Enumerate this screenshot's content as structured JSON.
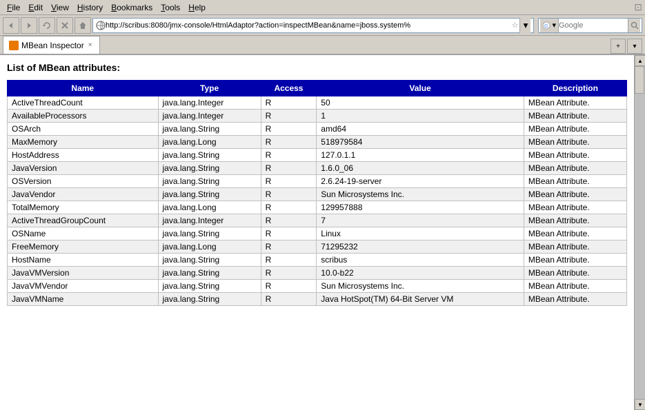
{
  "menubar": {
    "items": [
      {
        "label": "File",
        "underline": "F"
      },
      {
        "label": "Edit",
        "underline": "E"
      },
      {
        "label": "View",
        "underline": "V"
      },
      {
        "label": "History",
        "underline": "H"
      },
      {
        "label": "Bookmarks",
        "underline": "B"
      },
      {
        "label": "Tools",
        "underline": "T"
      },
      {
        "label": "Help",
        "underline": "H"
      }
    ]
  },
  "toolbar": {
    "url": "http://scribus:8080/jmx-console/HtmlAdaptor?action=inspectMBean&name=jboss.system%",
    "search_placeholder": "Google"
  },
  "tab": {
    "label": "MBean Inspector",
    "close": "×"
  },
  "page": {
    "title": "List of MBean attributes:",
    "table": {
      "headers": [
        "Name",
        "Type",
        "Access",
        "Value",
        "Description"
      ],
      "rows": [
        {
          "name": "ActiveThreadCount",
          "type": "java.lang.Integer",
          "access": "R",
          "value": "50",
          "description": "MBean Attribute."
        },
        {
          "name": "AvailableProcessors",
          "type": "java.lang.Integer",
          "access": "R",
          "value": "1",
          "description": "MBean Attribute."
        },
        {
          "name": "OSArch",
          "type": "java.lang.String",
          "access": "R",
          "value": "amd64",
          "description": "MBean Attribute."
        },
        {
          "name": "MaxMemory",
          "type": "java.lang.Long",
          "access": "R",
          "value": "518979584",
          "description": "MBean Attribute."
        },
        {
          "name": "HostAddress",
          "type": "java.lang.String",
          "access": "R",
          "value": "127.0.1.1",
          "description": "MBean Attribute."
        },
        {
          "name": "JavaVersion",
          "type": "java.lang.String",
          "access": "R",
          "value": "1.6.0_06",
          "description": "MBean Attribute."
        },
        {
          "name": "OSVersion",
          "type": "java.lang.String",
          "access": "R",
          "value": "2.6.24-19-server",
          "description": "MBean Attribute."
        },
        {
          "name": "JavaVendor",
          "type": "java.lang.String",
          "access": "R",
          "value": "Sun Microsystems Inc.",
          "description": "MBean Attribute."
        },
        {
          "name": "TotalMemory",
          "type": "java.lang.Long",
          "access": "R",
          "value": "129957888",
          "description": "MBean Attribute."
        },
        {
          "name": "ActiveThreadGroupCount",
          "type": "java.lang.Integer",
          "access": "R",
          "value": "7",
          "description": "MBean Attribute."
        },
        {
          "name": "OSName",
          "type": "java.lang.String",
          "access": "R",
          "value": "Linux",
          "description": "MBean Attribute."
        },
        {
          "name": "FreeMemory",
          "type": "java.lang.Long",
          "access": "R",
          "value": "71295232",
          "description": "MBean Attribute."
        },
        {
          "name": "HostName",
          "type": "java.lang.String",
          "access": "R",
          "value": "scribus",
          "description": "MBean Attribute."
        },
        {
          "name": "JavaVMVersion",
          "type": "java.lang.String",
          "access": "R",
          "value": "10.0-b22",
          "description": "MBean Attribute."
        },
        {
          "name": "JavaVMVendor",
          "type": "java.lang.String",
          "access": "R",
          "value": "Sun Microsystems Inc.",
          "description": "MBean Attribute."
        },
        {
          "name": "JavaVMName",
          "type": "java.lang.String",
          "access": "R",
          "value": "Java HotSpot(TM) 64-Bit Server VM",
          "description": "MBean Attribute."
        }
      ]
    }
  }
}
